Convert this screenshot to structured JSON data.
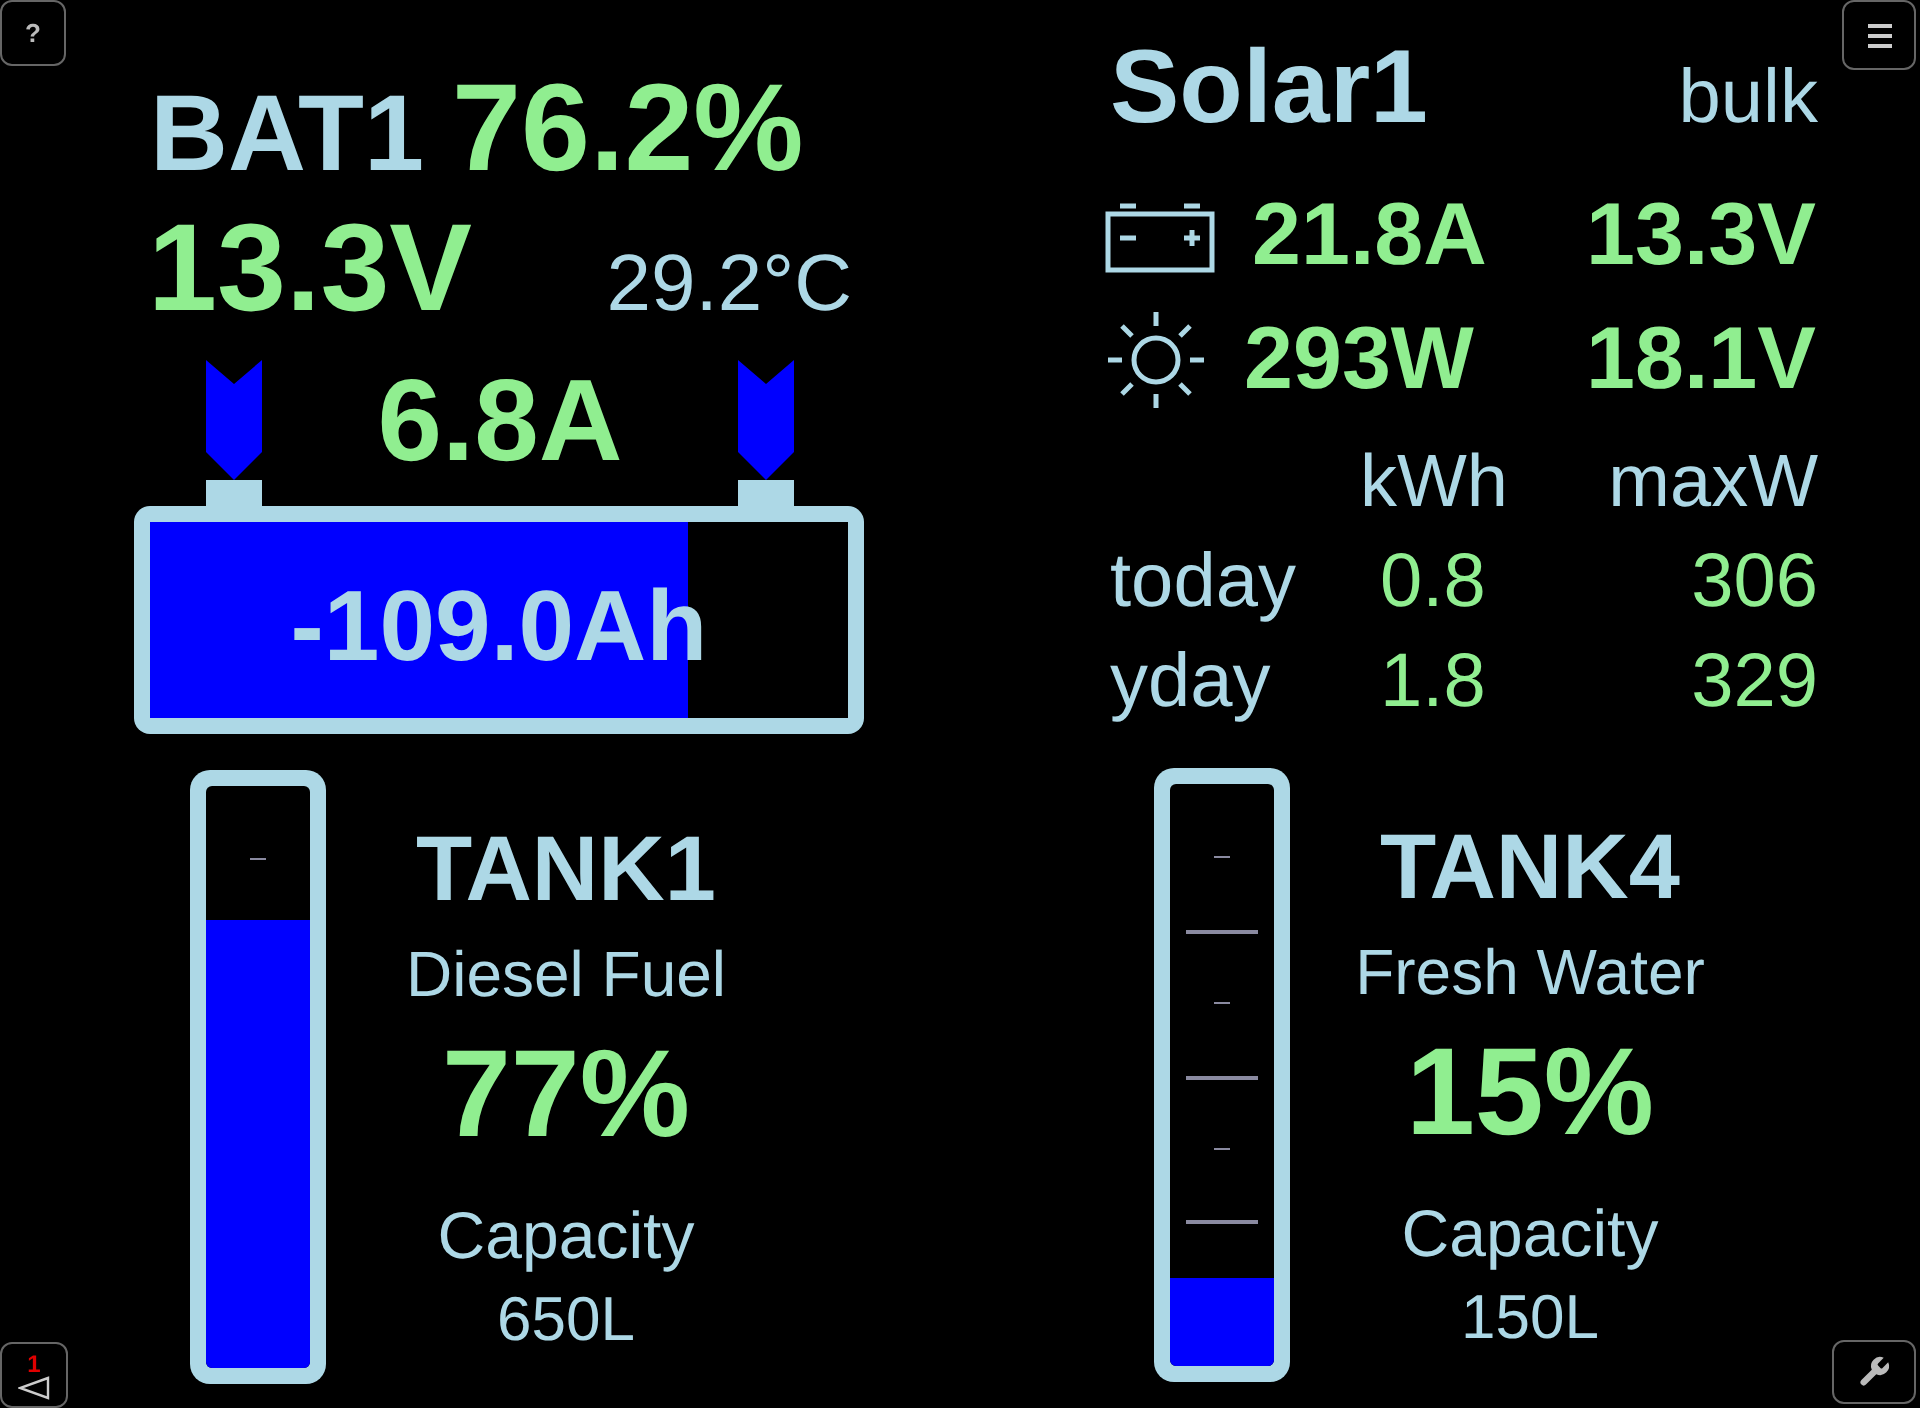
{
  "help_button": {
    "label": "?"
  },
  "alerts_button": {
    "count": "1"
  },
  "battery": {
    "name": "BAT1",
    "soc": "76.2%",
    "voltage": "13.3V",
    "temperature": "29.2°C",
    "current": "6.8A",
    "consumed": "-109.0Ah",
    "level": 0.77
  },
  "solar": {
    "name": "Solar1",
    "state": "bulk",
    "battery_current": "21.8A",
    "battery_voltage": "13.3V",
    "pv_power": "293W",
    "pv_voltage": "18.1V",
    "table": {
      "columns": [
        "kWh",
        "maxW"
      ],
      "rows": [
        {
          "label": "today",
          "values": [
            "0.8",
            "306"
          ]
        },
        {
          "label": "yday",
          "values": [
            "1.8",
            "329"
          ]
        }
      ]
    }
  },
  "tanks": [
    {
      "name": "TANK1",
      "fluid": "Diesel Fuel",
      "percent": "77%",
      "capacity_label": "Capacity",
      "capacity": "650L",
      "level": 0.77
    },
    {
      "name": "TANK4",
      "fluid": "Fresh Water",
      "percent": "15%",
      "capacity_label": "Capacity",
      "capacity": "150L",
      "level": 0.15
    }
  ]
}
